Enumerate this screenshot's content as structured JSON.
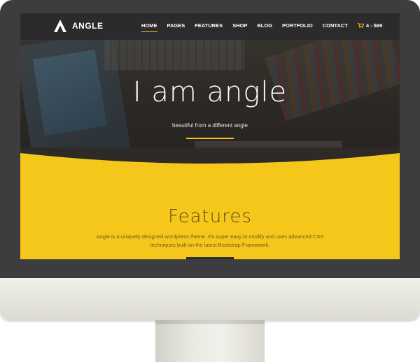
{
  "brand": {
    "name": "ANGLE"
  },
  "nav": {
    "items": [
      "HOME",
      "PAGES",
      "FEATURES",
      "SHOP",
      "BLOG",
      "PORTFOLIO",
      "CONTACT"
    ],
    "active": "HOME",
    "cart_label": "4 - $69"
  },
  "hero": {
    "title": "I am angle",
    "subtitle": "beautiful from a different angle"
  },
  "features": {
    "title": "Features",
    "description": "Angle is a uniquely designed wordpress theme. It's super easy to modify and uses advanced CSS techniques built on the latest Bootstrap Framework."
  },
  "colors": {
    "accent": "#f5c71a",
    "navbar": "#2b2b2d",
    "bezel": "#3d3d3f"
  },
  "icons": [
    "angle-logo-icon",
    "cart-icon"
  ]
}
